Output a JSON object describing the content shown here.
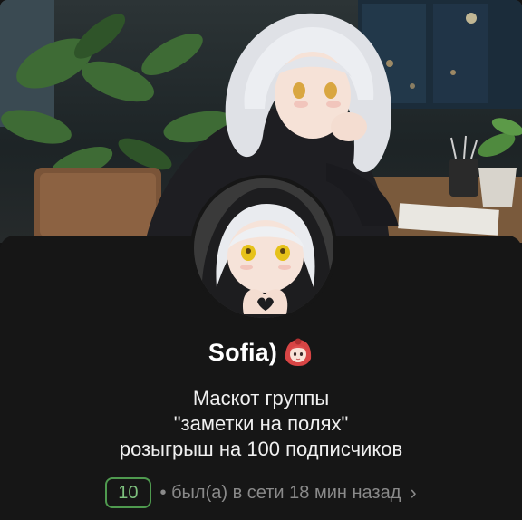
{
  "profile": {
    "name": "Sofia)",
    "name_emoji": "red-haired-girl-emoji",
    "bio_lines": [
      "Маскот группы",
      "\"заметки на полях\"",
      "розыгрыш на 100 подписчиков"
    ],
    "level_badge": "10",
    "status": "• был(а) в сети 18 мин назад",
    "status_chevron": "›"
  },
  "colors": {
    "background": "#161616",
    "badge_border": "#4f9a4f",
    "badge_text": "#7ec27e",
    "status_text": "#8a8a8a"
  },
  "icons": {
    "cover": "cover-image",
    "avatar": "avatar-image",
    "chevron": "chevron-right-icon"
  }
}
